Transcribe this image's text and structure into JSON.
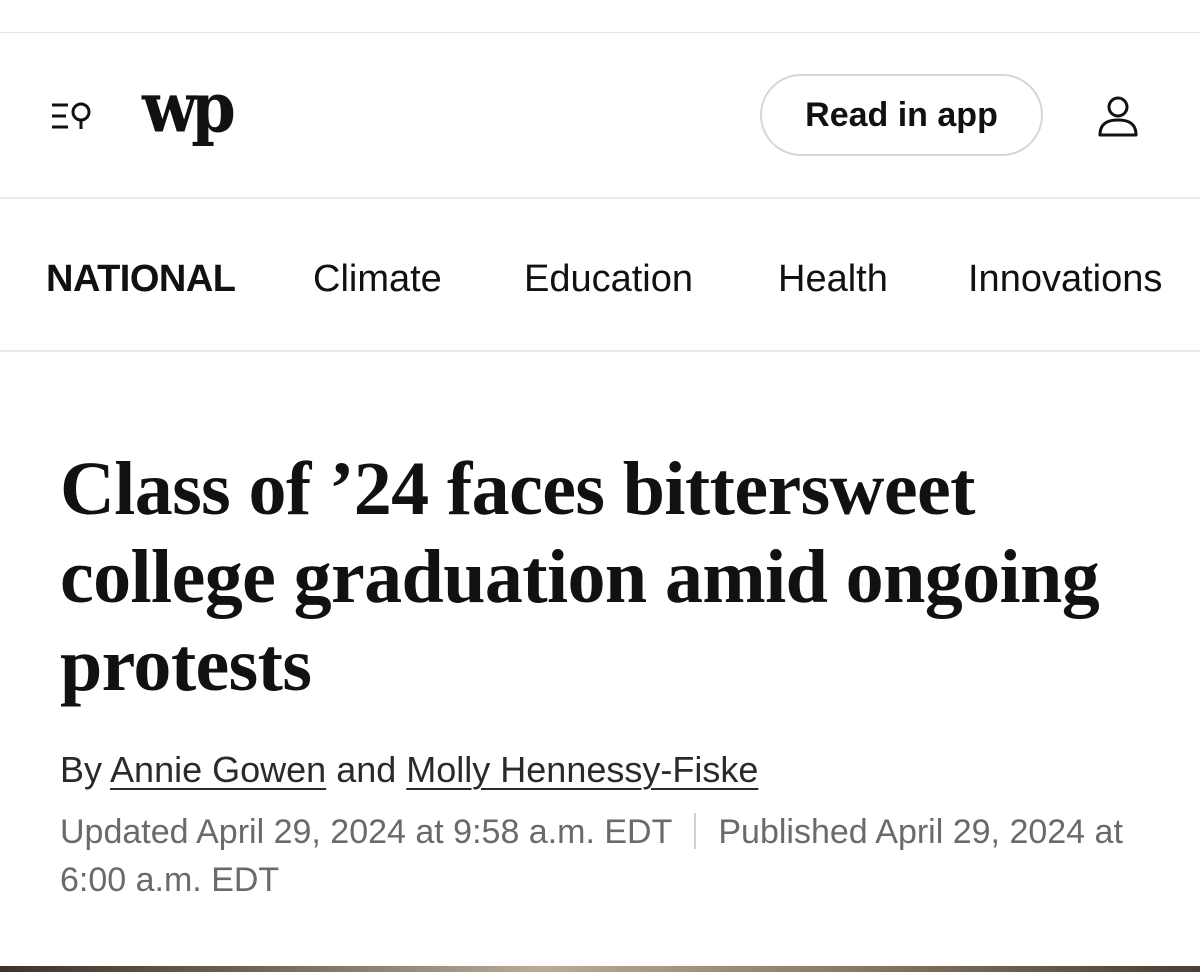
{
  "header": {
    "logo_text": "wp",
    "read_in_app_label": "Read in app",
    "icons": {
      "menu": "menu-search-icon",
      "account": "user-icon"
    }
  },
  "section_nav": {
    "section_title": "NATIONAL",
    "items": [
      {
        "label": "Climate"
      },
      {
        "label": "Education"
      },
      {
        "label": "Health"
      },
      {
        "label": "Innovations"
      }
    ]
  },
  "article": {
    "headline": "Class of ’24 faces bittersweet college graduation amid ongoing protests",
    "byline": {
      "prefix": "By",
      "authors": [
        "Annie Gowen",
        "Molly Hennessy-Fiske"
      ],
      "conjunction": "and"
    },
    "updated": "Updated April 29, 2024 at 9:58 a.m. EDT",
    "published": "Published April 29, 2024 at 6:00 a.m. EDT"
  }
}
